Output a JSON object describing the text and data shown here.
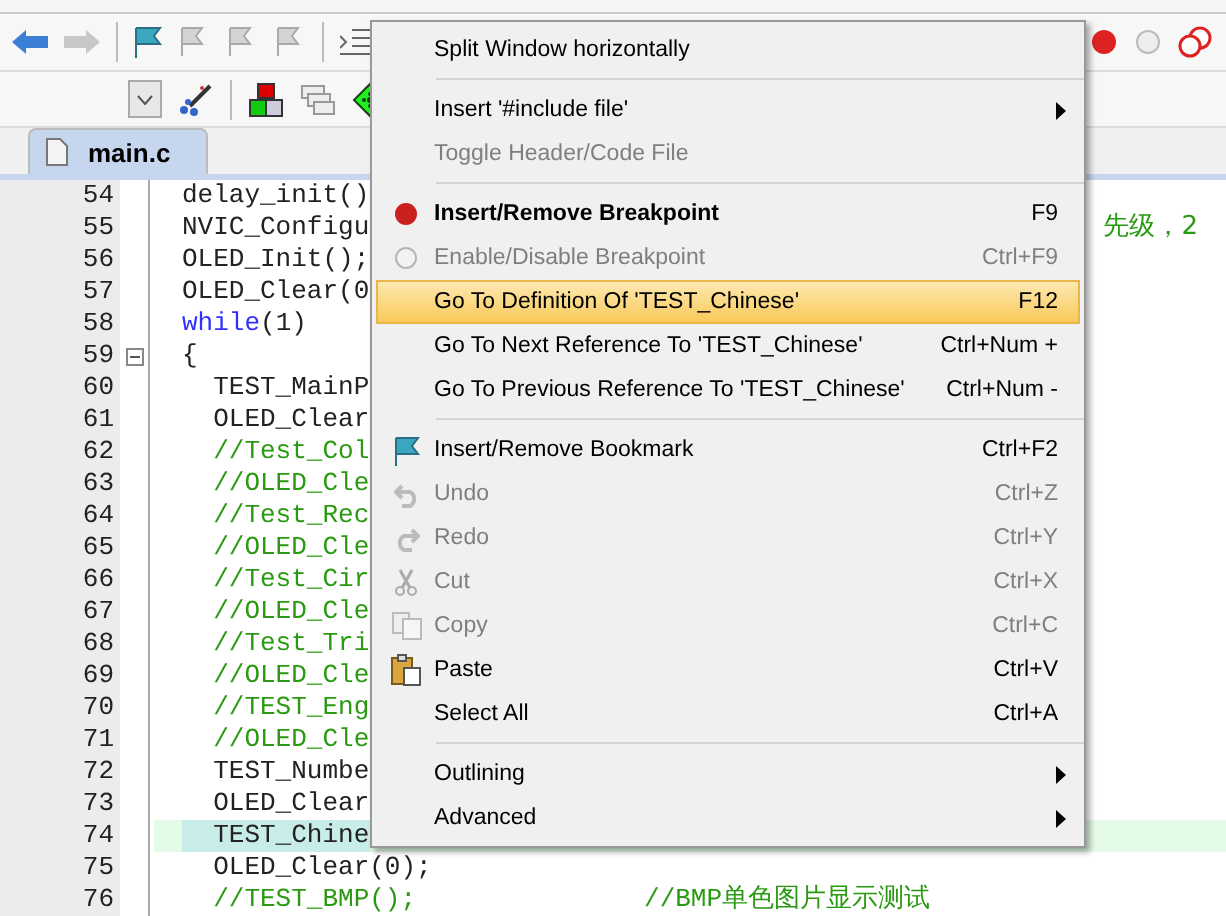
{
  "toolbar_1": {
    "buttons": [
      {
        "kind": "back",
        "disabled": false
      },
      {
        "kind": "forward",
        "disabled": true
      },
      {
        "kind": "bookmark",
        "disabled": false
      },
      {
        "kind": "bookmark-prev",
        "disabled": true
      },
      {
        "kind": "bookmark-next",
        "disabled": true
      },
      {
        "kind": "bookmark-clear",
        "disabled": true
      },
      {
        "kind": "indent",
        "disabled": false
      }
    ],
    "right_buttons": [
      {
        "kind": "breakpoint"
      },
      {
        "kind": "breakpoint-off"
      },
      {
        "kind": "breakpoint-clear"
      }
    ]
  },
  "toolbar_2": {
    "buttons": [
      {
        "kind": "dropdown"
      },
      {
        "kind": "wand"
      },
      {
        "kind": "blocks"
      },
      {
        "kind": "windows"
      },
      {
        "kind": "diamond"
      }
    ]
  },
  "tabs": [
    {
      "label": "main.c",
      "selected": true
    }
  ],
  "editor": {
    "lines": [
      {
        "number": "54",
        "current": false,
        "tokens": [
          {
            "kind": "code",
            "text": "delay_init()"
          }
        ]
      },
      {
        "number": "55",
        "current": false,
        "tokens": [
          {
            "kind": "code",
            "text": "NVIC_Configu"
          }
        ],
        "tail": "先级，2"
      },
      {
        "number": "56",
        "current": false,
        "tokens": [
          {
            "kind": "code",
            "text": "OLED_Init();"
          }
        ]
      },
      {
        "number": "57",
        "current": false,
        "tokens": [
          {
            "kind": "code",
            "text": "OLED_Clear(0"
          }
        ]
      },
      {
        "number": "58",
        "current": false,
        "tokens": [
          {
            "kind": "keyword",
            "text": "while"
          },
          {
            "kind": "code",
            "text": "(1)"
          }
        ]
      },
      {
        "number": "59",
        "current": false,
        "fold": true,
        "tokens": [
          {
            "kind": "code",
            "text": "{"
          }
        ]
      },
      {
        "number": "60",
        "current": false,
        "tokens": [
          {
            "kind": "code",
            "text": "  TEST_MainP"
          }
        ]
      },
      {
        "number": "61",
        "current": false,
        "tokens": [
          {
            "kind": "code",
            "text": "  OLED_Clear"
          }
        ]
      },
      {
        "number": "62",
        "current": false,
        "tokens": [
          {
            "kind": "comment",
            "text": "  //Test_Col"
          }
        ]
      },
      {
        "number": "63",
        "current": false,
        "tokens": [
          {
            "kind": "comment",
            "text": "  //OLED_Cle"
          }
        ]
      },
      {
        "number": "64",
        "current": false,
        "tokens": [
          {
            "kind": "comment",
            "text": "  //Test_Rec"
          }
        ]
      },
      {
        "number": "65",
        "current": false,
        "tokens": [
          {
            "kind": "comment",
            "text": "  //OLED_Cle"
          }
        ]
      },
      {
        "number": "66",
        "current": false,
        "tokens": [
          {
            "kind": "comment",
            "text": "  //Test_Cir"
          }
        ]
      },
      {
        "number": "67",
        "current": false,
        "tokens": [
          {
            "kind": "comment",
            "text": "  //OLED_Cle"
          }
        ]
      },
      {
        "number": "68",
        "current": false,
        "tokens": [
          {
            "kind": "comment",
            "text": "  //Test_Tri"
          }
        ]
      },
      {
        "number": "69",
        "current": false,
        "tokens": [
          {
            "kind": "comment",
            "text": "  //OLED_Cle"
          }
        ]
      },
      {
        "number": "70",
        "current": false,
        "tokens": [
          {
            "kind": "comment",
            "text": "  //TEST_Eng"
          }
        ]
      },
      {
        "number": "71",
        "current": false,
        "tokens": [
          {
            "kind": "comment",
            "text": "  //OLED_Cle"
          }
        ]
      },
      {
        "number": "72",
        "current": false,
        "tokens": [
          {
            "kind": "code",
            "text": "  TEST_Numbe"
          }
        ]
      },
      {
        "number": "73",
        "current": false,
        "tokens": [
          {
            "kind": "code",
            "text": "  OLED_Clear"
          }
        ]
      },
      {
        "number": "74",
        "current": true,
        "tokens": [
          {
            "kind": "code",
            "text": "  TEST_Chine"
          }
        ]
      },
      {
        "number": "75",
        "current": false,
        "tokens": [
          {
            "kind": "code",
            "text": "  OLED_Clear(0);"
          }
        ]
      },
      {
        "number": "76",
        "current": false,
        "tokens": [
          {
            "kind": "comment",
            "text": "  //TEST_BMP();"
          }
        ],
        "tail_comment": "//BMP单色图片显示测试"
      }
    ]
  },
  "context_menu": {
    "items": [
      {
        "kind": "item",
        "label": "Split Window horizontally",
        "disabled": false,
        "selected": false
      },
      {
        "kind": "separator"
      },
      {
        "kind": "item",
        "label": "Insert '#include file'",
        "disabled": false,
        "selected": false,
        "submenu": true
      },
      {
        "kind": "item",
        "label": "Toggle Header/Code File",
        "disabled": true,
        "selected": false
      },
      {
        "kind": "separator"
      },
      {
        "kind": "breakpoint",
        "label": "Insert/Remove Breakpoint",
        "shortcut": "F9",
        "bold": true,
        "disabled": false,
        "selected": false
      },
      {
        "kind": "breakpoint-off",
        "label": "Enable/Disable Breakpoint",
        "shortcut": "Ctrl+F9",
        "disabled": true,
        "selected": false
      },
      {
        "kind": "item",
        "label": "Go To Definition Of 'TEST_Chinese'",
        "shortcut": "F12",
        "disabled": false,
        "selected": true
      },
      {
        "kind": "item",
        "label": "Go To Next Reference To 'TEST_Chinese'",
        "shortcut": "Ctrl+Num +",
        "disabled": false,
        "selected": false
      },
      {
        "kind": "item",
        "label": "Go To Previous Reference To 'TEST_Chinese'",
        "shortcut": "Ctrl+Num -",
        "disabled": false,
        "selected": false
      },
      {
        "kind": "separator"
      },
      {
        "kind": "bookmark",
        "label": "Insert/Remove Bookmark",
        "shortcut": "Ctrl+F2",
        "disabled": false,
        "selected": false
      },
      {
        "kind": "undo",
        "label": "Undo",
        "shortcut": "Ctrl+Z",
        "disabled": true,
        "selected": false
      },
      {
        "kind": "redo",
        "label": "Redo",
        "shortcut": "Ctrl+Y",
        "disabled": true,
        "selected": false
      },
      {
        "kind": "cut",
        "label": "Cut",
        "shortcut": "Ctrl+X",
        "disabled": true,
        "selected": false
      },
      {
        "kind": "copy",
        "label": "Copy",
        "shortcut": "Ctrl+C",
        "disabled": true,
        "selected": false
      },
      {
        "kind": "paste",
        "label": "Paste",
        "shortcut": "Ctrl+V",
        "disabled": false,
        "selected": false
      },
      {
        "kind": "item",
        "label": "Select All",
        "shortcut": "Ctrl+A",
        "disabled": false,
        "selected": false
      },
      {
        "kind": "separator"
      },
      {
        "kind": "item",
        "label": "Outlining",
        "disabled": false,
        "selected": false,
        "submenu": true
      },
      {
        "kind": "item",
        "label": "Advanced",
        "disabled": false,
        "selected": false,
        "submenu": true
      }
    ]
  }
}
